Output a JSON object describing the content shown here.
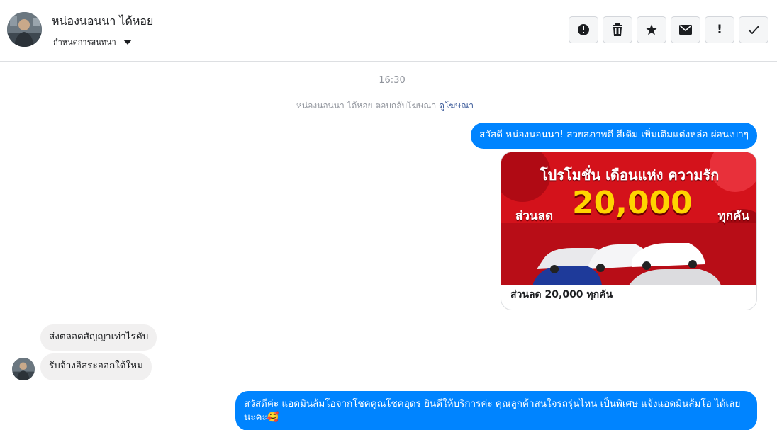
{
  "header": {
    "contact_name": "หน่องนอนนา ได้หอย",
    "conversation_settings": "กำหนดการสนทนา",
    "actions": [
      {
        "icon": "alert-circle-icon"
      },
      {
        "icon": "trash-icon"
      },
      {
        "icon": "star-icon"
      },
      {
        "icon": "envelope-icon"
      },
      {
        "icon": "exclamation-icon",
        "glyph": "!"
      },
      {
        "icon": "checkmark-icon"
      }
    ]
  },
  "thread": {
    "timestamp": "16:30",
    "ad_reply_text": "หน่องนอนนา ได้หอย ตอบกลับโฆษณา",
    "ad_reply_link": "ดูโฆษณา",
    "messages": [
      {
        "direction": "outgoing",
        "text": "สวัสดี หน่องนอนนา! สวยสภาพดี สีเดิม เพิ่มเติมแต่งหล่อ ผ่อนเบาๆ"
      },
      {
        "direction": "incoming",
        "text": "ส่งตลอดสัญญาเท่าไรคับ"
      },
      {
        "direction": "incoming",
        "text": "รับจ้างอิสระออกใด้ใหม"
      },
      {
        "direction": "outgoing",
        "text": "สวัสดีค่ะ แอดมินส้มโอจากโชคคูณโชคอุดร ยินดีให้บริการค่ะ   คุณลูกค้าสนใจรถรุ่นไหน เป็นพิเศษ แจ้งแอดมินส้มโอ ได้เลยนะคะ🥰"
      }
    ],
    "ad_card": {
      "image_headline": "โปรโมชั่น เดือนแห่ง ความรัก",
      "image_prefix": "ส่วนลด",
      "image_amount": "20,000",
      "image_suffix": "ทุกคัน",
      "caption": "ส่วนลด 20,000 ทุกคัน"
    }
  },
  "colors": {
    "outgoing_bubble": "#0084ff",
    "incoming_bubble": "#f1f0f0",
    "link": "#385898",
    "ad_red": "#d4121b",
    "ad_yellow": "#ffd400"
  }
}
